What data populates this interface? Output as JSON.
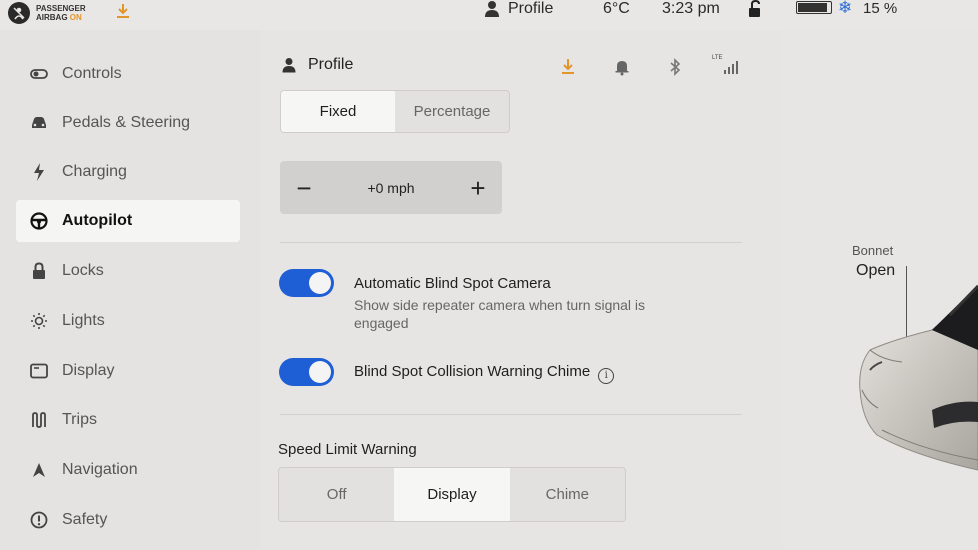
{
  "status_bar": {
    "airbag_line1": "PASSENGER",
    "airbag_line2": "AIRBAG",
    "airbag_state": "ON",
    "profile_label": "Profile",
    "temperature": "6°C",
    "time": "3:23 pm",
    "battery_percent": "15 %",
    "battery_level": 0.85
  },
  "sidebar": {
    "items": [
      {
        "label": "Controls",
        "icon": "toggle-icon"
      },
      {
        "label": "Pedals & Steering",
        "icon": "car-icon"
      },
      {
        "label": "Charging",
        "icon": "lightning-icon"
      },
      {
        "label": "Autopilot",
        "icon": "steering-wheel-icon",
        "active": true
      },
      {
        "label": "Locks",
        "icon": "lock-icon"
      },
      {
        "label": "Lights",
        "icon": "sun-icon"
      },
      {
        "label": "Display",
        "icon": "display-icon"
      },
      {
        "label": "Trips",
        "icon": "trips-icon"
      },
      {
        "label": "Navigation",
        "icon": "navigation-icon"
      },
      {
        "label": "Safety",
        "icon": "safety-icon"
      }
    ]
  },
  "main": {
    "header_title": "Profile",
    "offset_mode": {
      "options": [
        "Fixed",
        "Percentage"
      ],
      "selected": "Fixed"
    },
    "speed_offset": {
      "minus": "−",
      "value": "+0 mph",
      "plus": "+"
    },
    "blind_spot_camera": {
      "title": "Automatic Blind Spot Camera",
      "description": "Show side repeater camera when turn signal is engaged",
      "enabled": true
    },
    "blind_spot_chime": {
      "title": "Blind Spot Collision Warning Chime",
      "enabled": true
    },
    "speed_limit_warning": {
      "label": "Speed Limit Warning",
      "options": [
        "Off",
        "Display",
        "Chime"
      ],
      "selected": "Display"
    },
    "header_icons": [
      "download-icon",
      "bell-icon",
      "bluetooth-icon",
      "lte-signal-icon"
    ],
    "lte_label": "LTE"
  },
  "right_panel": {
    "bonnet_label": "Bonnet",
    "bonnet_state": "Open"
  },
  "colors": {
    "toggle_on": "#1f5fd6",
    "download_accent": "#e2952d",
    "snowflake": "#2b6cd6"
  }
}
